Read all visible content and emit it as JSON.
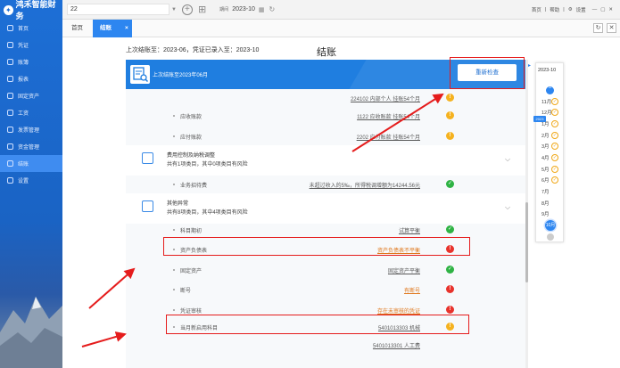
{
  "app": {
    "logo_text": "鸿禾智能财务"
  },
  "sidebar": {
    "items": [
      {
        "label": "首页",
        "active": false
      },
      {
        "label": "凭证",
        "active": false
      },
      {
        "label": "账簿",
        "active": false
      },
      {
        "label": "报表",
        "active": false
      },
      {
        "label": "固定资产",
        "active": false
      },
      {
        "label": "工资",
        "active": false
      },
      {
        "label": "发票管理",
        "active": false
      },
      {
        "label": "资金管理",
        "active": false
      },
      {
        "label": "结账",
        "active": true
      },
      {
        "label": "设置",
        "active": false
      }
    ]
  },
  "topbar": {
    "company": "22",
    "period_label": "期间",
    "period_value": "2023-10",
    "links": [
      "首页",
      "帮助",
      "设置"
    ]
  },
  "tabs": [
    {
      "label": "首页",
      "active": false
    },
    {
      "label": "结账",
      "active": true
    }
  ],
  "summary": "上次结账至：2023-06，凭证已录入至：2023-10",
  "page_title": "结账",
  "banner": {
    "text": "上次结账至2023年06月",
    "recheck_label": "重新检查"
  },
  "rows_top": [
    {
      "label": "",
      "value": "224102 内部个人 挂账54个月",
      "status": "warn"
    },
    {
      "label": "应收账款",
      "value": "1122 应收账款 挂账54个月",
      "status": "warn"
    },
    {
      "label": "应付账款",
      "value": "2202 应付账款 挂账54个月",
      "status": "warn"
    }
  ],
  "section_fee": {
    "title": "费用控制及纳税调整",
    "subtitle": "共有1项类目，其中0项类目有风险"
  },
  "row_fee": {
    "label": "业务招待费",
    "value": "未超过收入的5‰，所得税调增额为14244.56元",
    "status": "ok"
  },
  "section_other": {
    "title": "其他异常",
    "subtitle": "共有8项类目，其中4项类目有风险"
  },
  "rows_other": [
    {
      "label": "科目期初",
      "value": "试算平衡",
      "status": "ok"
    },
    {
      "label": "资产负债表",
      "value": "资产负债表不平衡",
      "status": "err"
    },
    {
      "label": "固定资产",
      "value": "固定资产平衡",
      "status": "ok"
    },
    {
      "label": "断号",
      "value": "有断号",
      "status": "err"
    },
    {
      "label": "凭证审核",
      "value": "存在未审核的凭证",
      "status": "err"
    },
    {
      "label": "当月新启用科目",
      "value": "5401013303 机械",
      "status": "warn"
    },
    {
      "label": "",
      "value": "5401013301 人工费",
      "status": ""
    }
  ],
  "months": {
    "header": "2023-10",
    "list": [
      {
        "label": "11月",
        "checked": true
      },
      {
        "label": "12月",
        "checked": true
      },
      {
        "label": "1月",
        "checked": true
      },
      {
        "label": "2月",
        "checked": true
      },
      {
        "label": "3月",
        "checked": true
      },
      {
        "label": "4月",
        "checked": true
      },
      {
        "label": "5月",
        "checked": true
      },
      {
        "label": "6月",
        "checked": true
      },
      {
        "label": "7月",
        "checked": false
      },
      {
        "label": "8月",
        "checked": false
      },
      {
        "label": "9月",
        "checked": false
      }
    ],
    "current": "10月",
    "year_tag": "2023"
  },
  "colors": {
    "brand": "#1f7ee0",
    "warn": "#f5b21f",
    "ok": "#2fb344",
    "err": "#e8332c",
    "annotation": "#e51c1c"
  }
}
